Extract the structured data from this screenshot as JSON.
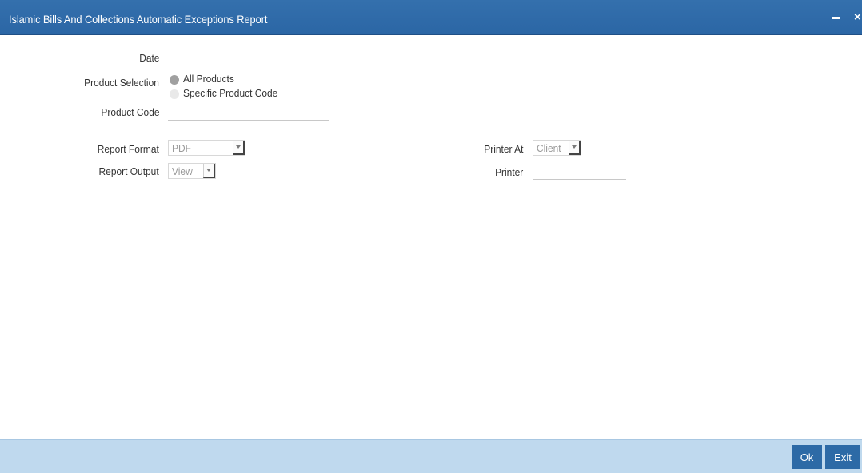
{
  "window": {
    "title": "Islamic Bills And Collections Automatic Exceptions Report",
    "minimize_glyph": "-",
    "close_glyph": "×"
  },
  "form": {
    "date_label": "Date",
    "date_value": "",
    "product_selection_label": "Product Selection",
    "product_selection_options": [
      "All Products",
      "Specific Product Code"
    ],
    "product_selection_selected": "All Products",
    "product_code_label": "Product Code",
    "product_code_value": "",
    "report_format_label": "Report Format",
    "report_format_value": "PDF",
    "report_output_label": "Report Output",
    "report_output_value": "View",
    "printer_at_label": "Printer At",
    "printer_at_value": "Client",
    "printer_label": "Printer",
    "printer_value": ""
  },
  "footer": {
    "ok_label": "Ok",
    "exit_label": "Exit"
  },
  "colors": {
    "titlebar": "#2b66a5",
    "footer": "#bfd9ee",
    "button": "#2d6aa6"
  }
}
